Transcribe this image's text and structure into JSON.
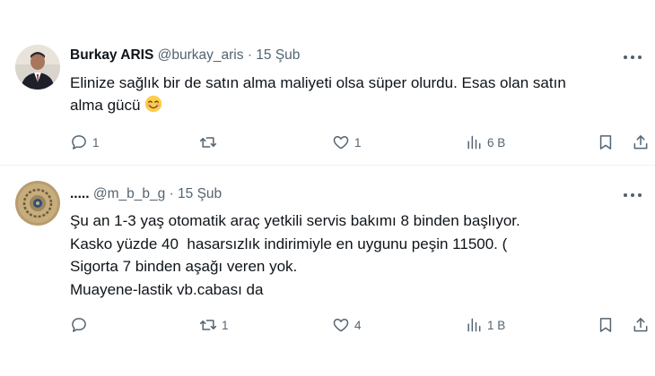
{
  "tweets": [
    {
      "author_name": "Burkay ARIS",
      "handle": "@burkay_aris",
      "separator": "·",
      "date": "15 Şub",
      "text_lines": [
        "Elinize sağlık bir de satın alma maliyeti olsa süper olurdu. Esas olan satın",
        "alma gücü"
      ],
      "emoji": "smiling-face-icon",
      "replies": "1",
      "retweets": "",
      "likes": "1",
      "views": "6 B"
    },
    {
      "author_name": ".....",
      "handle": "@m_b_b_g",
      "separator": "·",
      "date": "15 Şub",
      "text_lines": [
        "Şu an 1-3 yaş otomatik araç yetkili servis bakımı 8 binden başlıyor.",
        "Kasko yüzde 40  hasarsızlık indirimiyle en uygunu peşin 11500. (",
        "Sigorta 7 binden aşağı veren yok.",
        "Muayene-lastik vb.cabası da"
      ],
      "replies": "",
      "retweets": "1",
      "likes": "4",
      "views": "1 B"
    }
  ],
  "colors": {
    "text": "#0f1419",
    "secondary": "#536471",
    "divider": "#eff3f4"
  }
}
